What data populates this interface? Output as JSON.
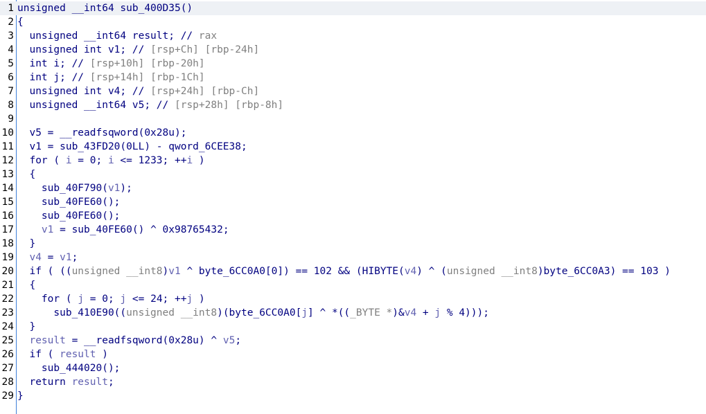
{
  "colors": {
    "code": "#000080",
    "comment_gray": "#7f7f7f",
    "variable": "#6060b0",
    "gutter_border": "#3d7fd9",
    "highlight_line": "#eef1f5"
  },
  "lines": [
    {
      "n": "1",
      "highlight": true,
      "tokens": [
        {
          "t": "unsigned __int64 sub_400D35()",
          "c": "c"
        }
      ]
    },
    {
      "n": "2",
      "tokens": [
        {
          "t": "{",
          "c": "c"
        }
      ]
    },
    {
      "n": "3",
      "tokens": [
        {
          "t": "  unsigned __int64 result; // ",
          "c": "c"
        },
        {
          "t": "rax",
          "c": "g"
        }
      ]
    },
    {
      "n": "4",
      "tokens": [
        {
          "t": "  unsigned int v1; // ",
          "c": "c"
        },
        {
          "t": "[rsp+Ch] [rbp-24h]",
          "c": "g"
        }
      ]
    },
    {
      "n": "5",
      "tokens": [
        {
          "t": "  int i; // ",
          "c": "c"
        },
        {
          "t": "[rsp+10h] [rbp-20h]",
          "c": "g"
        }
      ]
    },
    {
      "n": "6",
      "tokens": [
        {
          "t": "  int j; // ",
          "c": "c"
        },
        {
          "t": "[rsp+14h] [rbp-1Ch]",
          "c": "g"
        }
      ]
    },
    {
      "n": "7",
      "tokens": [
        {
          "t": "  unsigned int v4; // ",
          "c": "c"
        },
        {
          "t": "[rsp+24h] [rbp-Ch]",
          "c": "g"
        }
      ]
    },
    {
      "n": "8",
      "tokens": [
        {
          "t": "  unsigned __int64 v5; // ",
          "c": "c"
        },
        {
          "t": "[rsp+28h] [rbp-8h]",
          "c": "g"
        }
      ]
    },
    {
      "n": "9",
      "tokens": []
    },
    {
      "n": "10",
      "tokens": [
        {
          "t": "  v5 = __readfsqword(0x28u);",
          "c": "c"
        }
      ]
    },
    {
      "n": "11",
      "tokens": [
        {
          "t": "  v1 = sub_43FD20(0LL) - qword_6CEE38;",
          "c": "c"
        }
      ]
    },
    {
      "n": "12",
      "tokens": [
        {
          "t": "  for ( ",
          "c": "c"
        },
        {
          "t": "i",
          "c": "v"
        },
        {
          "t": " = 0; ",
          "c": "c"
        },
        {
          "t": "i",
          "c": "v"
        },
        {
          "t": " <= 1233; ++",
          "c": "c"
        },
        {
          "t": "i",
          "c": "v"
        },
        {
          "t": " )",
          "c": "c"
        }
      ]
    },
    {
      "n": "13",
      "tokens": [
        {
          "t": "  {",
          "c": "c"
        }
      ]
    },
    {
      "n": "14",
      "tokens": [
        {
          "t": "    sub_40F790(",
          "c": "c"
        },
        {
          "t": "v1",
          "c": "v"
        },
        {
          "t": ");",
          "c": "c"
        }
      ]
    },
    {
      "n": "15",
      "tokens": [
        {
          "t": "    sub_40FE60();",
          "c": "c"
        }
      ]
    },
    {
      "n": "16",
      "tokens": [
        {
          "t": "    sub_40FE60();",
          "c": "c"
        }
      ]
    },
    {
      "n": "17",
      "tokens": [
        {
          "t": "    ",
          "c": "c"
        },
        {
          "t": "v1",
          "c": "v"
        },
        {
          "t": " = sub_40FE60() ^ 0x98765432;",
          "c": "c"
        }
      ]
    },
    {
      "n": "18",
      "tokens": [
        {
          "t": "  }",
          "c": "c"
        }
      ]
    },
    {
      "n": "19",
      "tokens": [
        {
          "t": "  ",
          "c": "c"
        },
        {
          "t": "v4",
          "c": "v"
        },
        {
          "t": " = ",
          "c": "c"
        },
        {
          "t": "v1",
          "c": "v"
        },
        {
          "t": ";",
          "c": "c"
        }
      ]
    },
    {
      "n": "20",
      "tokens": [
        {
          "t": "  if ( ((",
          "c": "c"
        },
        {
          "t": "unsigned __int8",
          "c": "g"
        },
        {
          "t": ")",
          "c": "c"
        },
        {
          "t": "v1",
          "c": "v"
        },
        {
          "t": " ^ byte_6CC0A0[0]) == 102 && (HIBYTE(",
          "c": "c"
        },
        {
          "t": "v4",
          "c": "v"
        },
        {
          "t": ") ^ (",
          "c": "c"
        },
        {
          "t": "unsigned __int8",
          "c": "g"
        },
        {
          "t": ")byte_6CC0A3) == 103 )",
          "c": "c"
        }
      ]
    },
    {
      "n": "21",
      "tokens": [
        {
          "t": "  {",
          "c": "c"
        }
      ]
    },
    {
      "n": "22",
      "tokens": [
        {
          "t": "    for ( ",
          "c": "c"
        },
        {
          "t": "j",
          "c": "v"
        },
        {
          "t": " = 0; ",
          "c": "c"
        },
        {
          "t": "j",
          "c": "v"
        },
        {
          "t": " <= 24; ++",
          "c": "c"
        },
        {
          "t": "j",
          "c": "v"
        },
        {
          "t": " )",
          "c": "c"
        }
      ]
    },
    {
      "n": "23",
      "tokens": [
        {
          "t": "      sub_410E90((",
          "c": "c"
        },
        {
          "t": "unsigned __int8",
          "c": "g"
        },
        {
          "t": ")(byte_6CC0A0[",
          "c": "c"
        },
        {
          "t": "j",
          "c": "v"
        },
        {
          "t": "] ^ *((",
          "c": "c"
        },
        {
          "t": "_BYTE *",
          "c": "g"
        },
        {
          "t": ")&",
          "c": "c"
        },
        {
          "t": "v4",
          "c": "v"
        },
        {
          "t": " + ",
          "c": "c"
        },
        {
          "t": "j",
          "c": "v"
        },
        {
          "t": " % 4)));",
          "c": "c"
        }
      ]
    },
    {
      "n": "24",
      "tokens": [
        {
          "t": "  }",
          "c": "c"
        }
      ]
    },
    {
      "n": "25",
      "tokens": [
        {
          "t": "  ",
          "c": "c"
        },
        {
          "t": "result",
          "c": "v"
        },
        {
          "t": " = __readfsqword(0x28u) ^ ",
          "c": "c"
        },
        {
          "t": "v5",
          "c": "v"
        },
        {
          "t": ";",
          "c": "c"
        }
      ]
    },
    {
      "n": "26",
      "tokens": [
        {
          "t": "  if ( ",
          "c": "c"
        },
        {
          "t": "result",
          "c": "v"
        },
        {
          "t": " )",
          "c": "c"
        }
      ]
    },
    {
      "n": "27",
      "tokens": [
        {
          "t": "    sub_444020();",
          "c": "c"
        }
      ]
    },
    {
      "n": "28",
      "tokens": [
        {
          "t": "  return ",
          "c": "c"
        },
        {
          "t": "result",
          "c": "v"
        },
        {
          "t": ";",
          "c": "c"
        }
      ]
    },
    {
      "n": "29",
      "tokens": [
        {
          "t": "}",
          "c": "c"
        }
      ]
    }
  ]
}
